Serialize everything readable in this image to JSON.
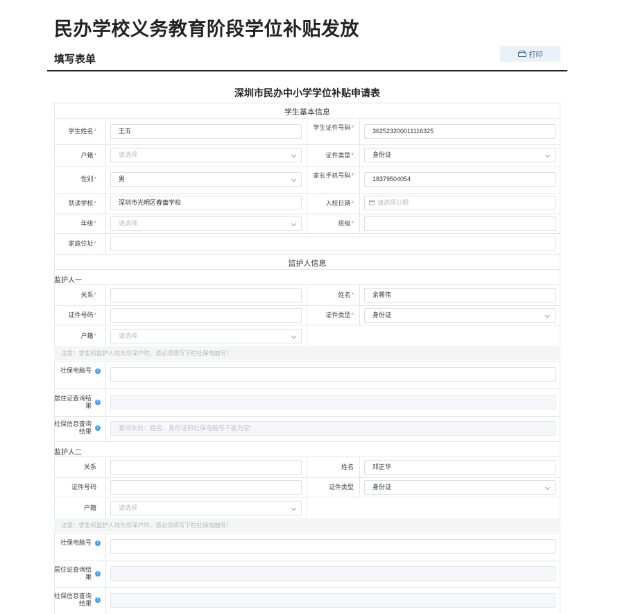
{
  "page": {
    "title": "民办学校义务教育阶段学位补贴发放",
    "section_title": "填写表单",
    "print_label": "打印"
  },
  "form": {
    "title": "深圳市民办中小学学位补贴申请表",
    "student_section": "学生基本信息",
    "guardian_section": "监护人信息",
    "student": {
      "name_label": "学生姓名",
      "name_value": "王五",
      "id_label": "学生证件号码",
      "id_value": "362523200011116325",
      "hukou_label": "户籍",
      "hukou_placeholder": "请选择",
      "id_type_label": "证件类型",
      "id_type_value": "身份证",
      "gender_label": "性别",
      "gender_value": "男",
      "parent_phone_label": "家长手机号码",
      "parent_phone_value": "18379504054",
      "school_label": "就读学校",
      "school_value": "深圳市光明区春蕾学校",
      "enroll_date_label": "入校日期",
      "enroll_date_placeholder": "请选择日期",
      "grade_label": "年级",
      "grade_placeholder": "请选择",
      "class_label": "班级",
      "class_value": "",
      "address_label": "家庭住址",
      "address_value": ""
    },
    "guardian1": {
      "header": "监护人一",
      "relation_label": "关系",
      "relation_value": "",
      "name_label": "姓名",
      "name_value": "余蒋伟",
      "id_label": "证件号码",
      "id_value": "",
      "id_type_label": "证件类型",
      "id_type_value": "身份证",
      "hukou_label": "户籍",
      "hukou_placeholder": "请选择",
      "note": "注意：学生和监护人均为非深户时，请必须填写下栏社保电脑号！",
      "social_no_label": "社保电脑号",
      "social_no_value": "",
      "residence_result_label": "居住证查询结果",
      "residence_result_value": "",
      "social_result_label": "社保信息查询结果",
      "social_result_value": "查询失败：姓名、身份证和社保电脑号不能为空!"
    },
    "guardian2": {
      "header": "监护人二",
      "relation_label": "关系",
      "relation_value": "",
      "name_label": "姓名",
      "name_value": "邓正华",
      "id_label": "证件号码",
      "id_value": "",
      "id_type_label": "证件类型",
      "id_type_value": "身份证",
      "hukou_label": "户籍",
      "hukou_placeholder": "请选择",
      "note": "注意：学生和监护人均为非深户时，请必须填写下栏社保电脑号！",
      "social_no_label": "社保电脑号",
      "social_no_value": "",
      "residence_result_label": "居住证查询结果",
      "residence_result_value": "",
      "social_result_label": "社保信息查询结果",
      "social_result_value": ""
    }
  },
  "icons": {
    "print": "printer-icon",
    "calendar": "calendar-icon",
    "info": "info-icon",
    "dropdown": "chevron-down-icon"
  },
  "colors": {
    "required": "#f56c6c",
    "info": "#409eff",
    "print_bg": "#eaf1f8"
  }
}
